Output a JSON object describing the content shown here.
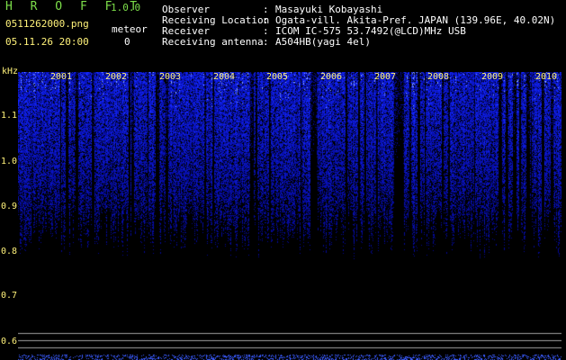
{
  "app": {
    "title": "H R O F F T",
    "version": "1.0.0",
    "filename": "0511262000.png",
    "meteor_label": "meteor",
    "datetime": "05.11.26 20:00",
    "meteor_count": "0"
  },
  "info": [
    {
      "key": "Observer",
      "value": "Masayuki Kobayashi"
    },
    {
      "key": "Receiving Location",
      "value": "Ogata-vill. Akita-Pref. JAPAN (139.96E, 40.02N)"
    },
    {
      "key": "Receiver",
      "value": "ICOM IC-575 53.7492(@LCD)MHz USB"
    },
    {
      "key": "Receiving antenna",
      "value": "A504HB(yagi 4el)"
    }
  ],
  "separator": ":",
  "spectrogram": {
    "y_unit": "kHz",
    "y_ticks": [
      {
        "label": "1.1",
        "value": 1.1
      },
      {
        "label": "1.0",
        "value": 1.0
      },
      {
        "label": "0.9",
        "value": 0.9
      },
      {
        "label": "0.8",
        "value": 0.8
      },
      {
        "label": "0.7",
        "value": 0.7
      },
      {
        "label": "0.6",
        "value": 0.6
      }
    ],
    "years": [
      "2001",
      "2002",
      "2003",
      "2004",
      "2005",
      "2006",
      "2007",
      "2008",
      "2009",
      "2010"
    ],
    "colors": {
      "background": "#000000",
      "signal": "#2f4dff",
      "label": "#fff27a",
      "header_green": "#7ddf4a"
    }
  }
}
